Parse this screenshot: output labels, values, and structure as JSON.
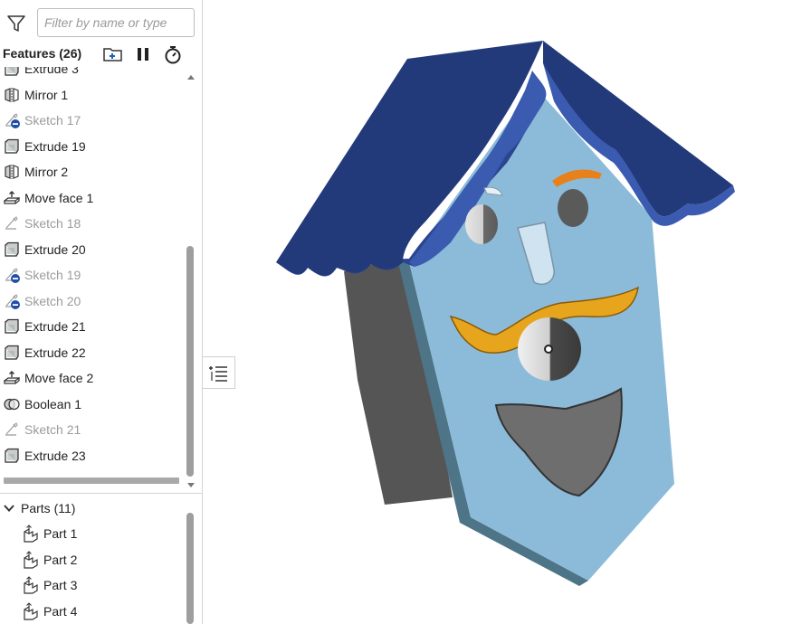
{
  "filter": {
    "placeholder": "Filter by name or type"
  },
  "features": {
    "title": "Features (26)",
    "items": [
      {
        "label": "Extrude 3",
        "type": "extrude",
        "suppressed": false
      },
      {
        "label": "Mirror 1",
        "type": "mirror",
        "suppressed": false
      },
      {
        "label": "Sketch 17",
        "type": "sketch-error",
        "suppressed": true
      },
      {
        "label": "Extrude 19",
        "type": "extrude",
        "suppressed": false
      },
      {
        "label": "Mirror 2",
        "type": "mirror",
        "suppressed": false
      },
      {
        "label": "Move face 1",
        "type": "move-face",
        "suppressed": false
      },
      {
        "label": "Sketch 18",
        "type": "sketch",
        "suppressed": true
      },
      {
        "label": "Extrude 20",
        "type": "extrude",
        "suppressed": false
      },
      {
        "label": "Sketch 19",
        "type": "sketch-error",
        "suppressed": true
      },
      {
        "label": "Sketch 20",
        "type": "sketch-error",
        "suppressed": true
      },
      {
        "label": "Extrude 21",
        "type": "extrude",
        "suppressed": false
      },
      {
        "label": "Extrude 22",
        "type": "extrude",
        "suppressed": false
      },
      {
        "label": "Move face 2",
        "type": "move-face",
        "suppressed": false
      },
      {
        "label": "Boolean 1",
        "type": "boolean",
        "suppressed": false
      },
      {
        "label": "Sketch 21",
        "type": "sketch",
        "suppressed": true
      },
      {
        "label": "Extrude 23",
        "type": "extrude",
        "suppressed": false
      }
    ]
  },
  "parts": {
    "title": "Parts (11)",
    "items": [
      {
        "label": "Part 1"
      },
      {
        "label": "Part 2"
      },
      {
        "label": "Part 3"
      },
      {
        "label": "Part 4"
      }
    ]
  },
  "icons": {
    "filter": "filter-funnel-icon",
    "new_folder": "add-folder-icon",
    "pause": "pause-icon",
    "rollback_timer": "stopwatch-icon",
    "part": "part-icon",
    "toggle_list": "list-panel-icon"
  },
  "colors": {
    "roof": "#233a7a",
    "face": "#8cbbd9",
    "mustache": "#e7a51d",
    "eyebrow": "#e8801c",
    "beard": "#6e6e6e",
    "side": "#555555",
    "sketch_error_badge": "#1f4fa8"
  }
}
